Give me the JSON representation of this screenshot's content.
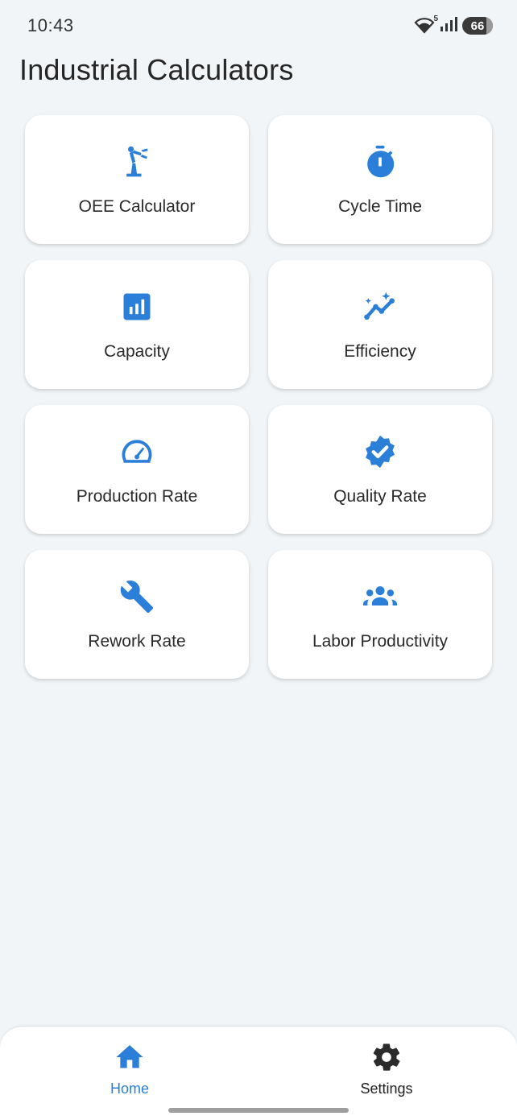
{
  "status_bar": {
    "time": "10:43",
    "wifi_badge": "5",
    "battery": "66"
  },
  "title": "Industrial Calculators",
  "cards": [
    {
      "label": "OEE Calculator",
      "icon": "robot-arm-icon"
    },
    {
      "label": "Cycle Time",
      "icon": "stopwatch-icon"
    },
    {
      "label": "Capacity",
      "icon": "bar-chart-icon"
    },
    {
      "label": "Efficiency",
      "icon": "trend-sparkle-icon"
    },
    {
      "label": "Production Rate",
      "icon": "speedometer-icon"
    },
    {
      "label": "Quality Rate",
      "icon": "verified-badge-icon"
    },
    {
      "label": "Rework Rate",
      "icon": "wrench-icon"
    },
    {
      "label": "Labor Productivity",
      "icon": "group-icon"
    }
  ],
  "bottom_nav": {
    "home": {
      "label": "Home",
      "icon": "home-icon",
      "active": true
    },
    "settings": {
      "label": "Settings",
      "icon": "gear-icon",
      "active": false
    }
  },
  "colors": {
    "accent": "#2b7fd9",
    "background": "#f2f5f7",
    "card": "#ffffff"
  }
}
